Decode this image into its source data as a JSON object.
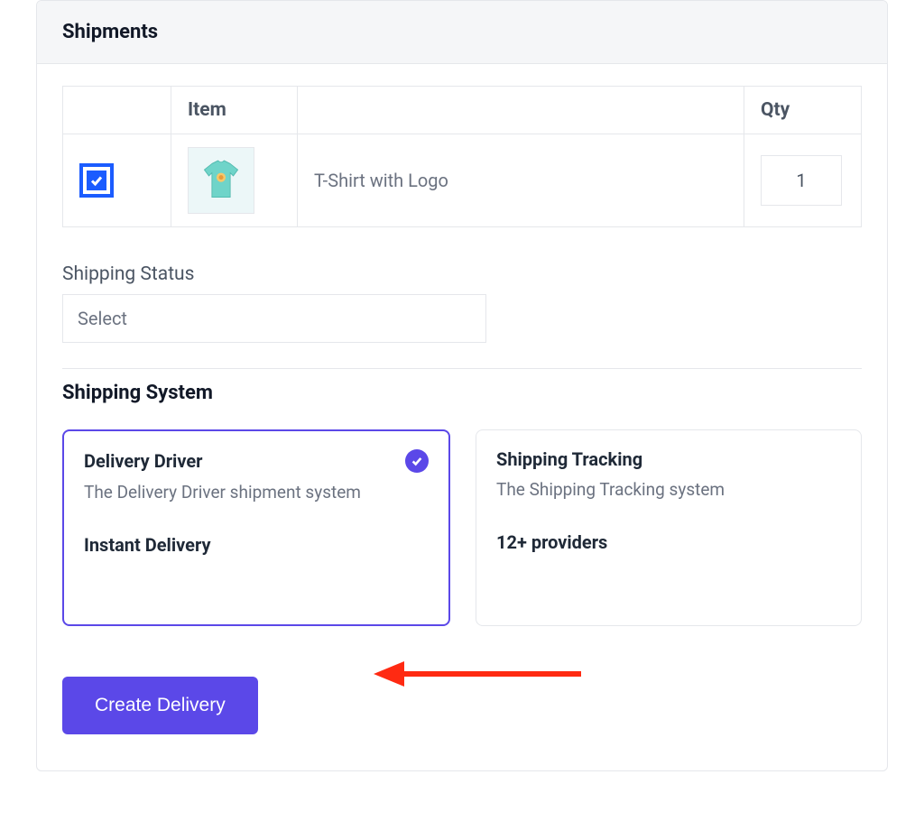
{
  "panel": {
    "title": "Shipments"
  },
  "table": {
    "headers": {
      "item": "Item",
      "qty": "Qty"
    },
    "rows": [
      {
        "checked": true,
        "name": "T-Shirt with Logo",
        "qty": "1"
      }
    ]
  },
  "shipping_status": {
    "label": "Shipping Status",
    "selected": "Select"
  },
  "shipping_system": {
    "heading": "Shipping System",
    "options": [
      {
        "title": "Delivery Driver",
        "desc": "The Delivery Driver shipment system",
        "footer": "Instant Delivery",
        "selected": true
      },
      {
        "title": "Shipping Tracking",
        "desc": "The Shipping Tracking system",
        "footer": "12+ providers",
        "selected": false
      }
    ]
  },
  "actions": {
    "create": "Create Delivery"
  }
}
